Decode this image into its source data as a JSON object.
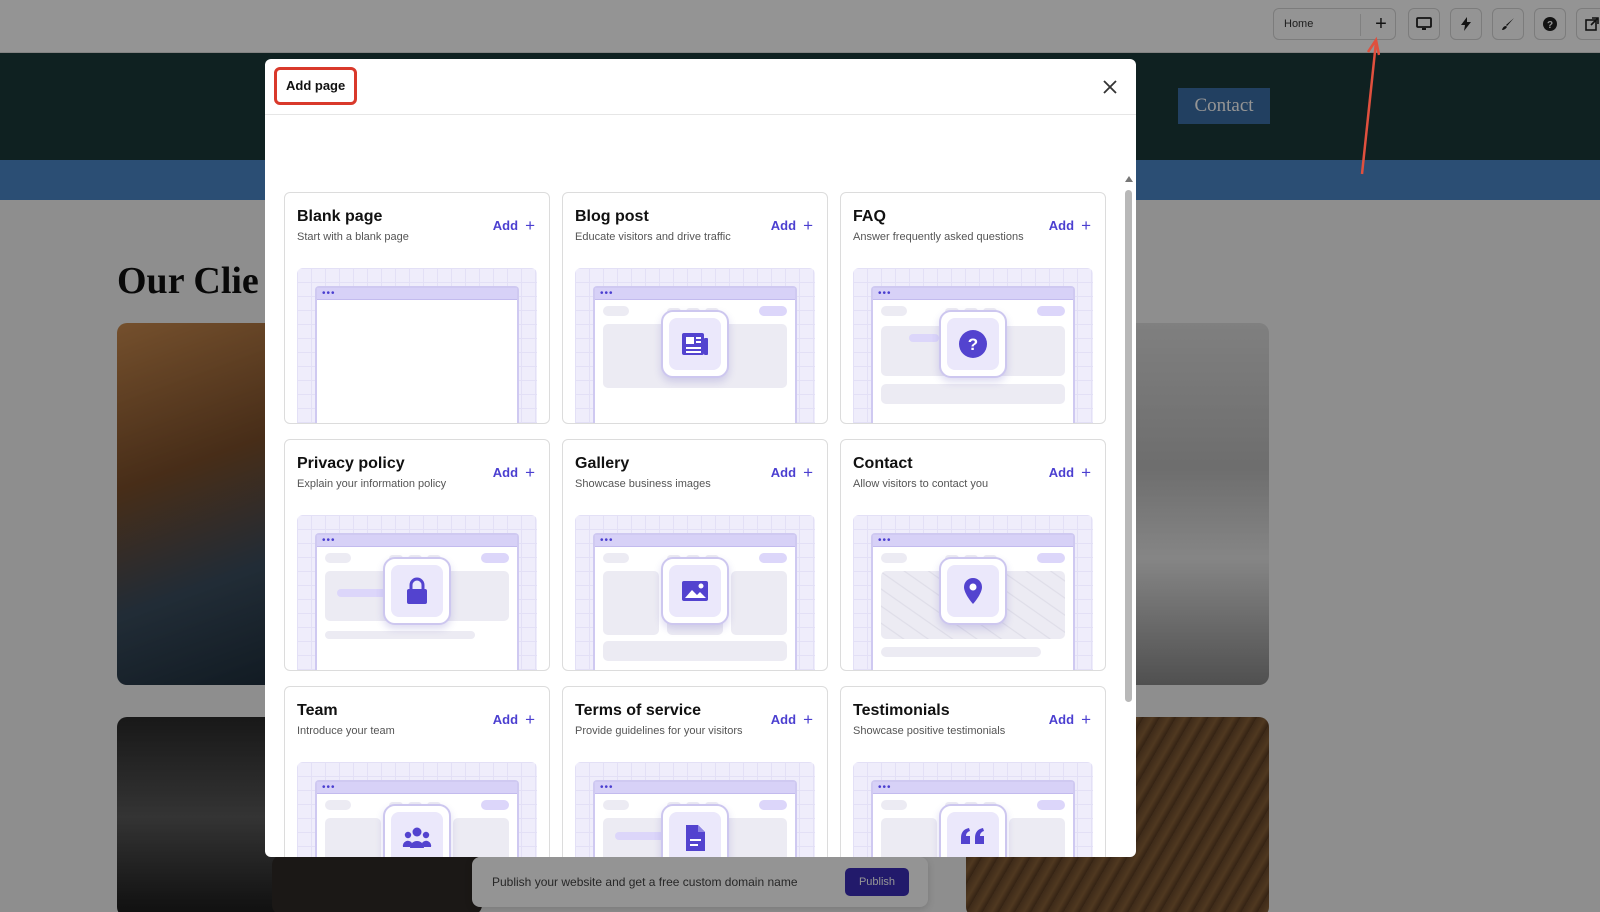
{
  "editor": {
    "page_selector_value": "Home",
    "add_page_icon": "plus-icon",
    "toolbar_icons": [
      "desktop-icon",
      "lightning-icon",
      "brush-icon",
      "help-icon",
      "external-link-icon"
    ]
  },
  "site": {
    "nav_contact": "Contact",
    "heading": "Our Clie",
    "publish_text": "Publish your website and get a free custom domain name",
    "publish_button": "Publish"
  },
  "modal": {
    "title": "Add page",
    "close_icon": "close-icon",
    "add_label": "Add",
    "cards": [
      {
        "title": "Blank page",
        "description": "Start with a blank page",
        "icon": "blank-page-icon"
      },
      {
        "title": "Blog post",
        "description": "Educate visitors and drive traffic",
        "icon": "newspaper-icon"
      },
      {
        "title": "FAQ",
        "description": "Answer frequently asked questions",
        "icon": "question-icon"
      },
      {
        "title": "Privacy policy",
        "description": "Explain your information policy",
        "icon": "lock-icon"
      },
      {
        "title": "Gallery",
        "description": "Showcase business images",
        "icon": "image-icon"
      },
      {
        "title": "Contact",
        "description": "Allow visitors to contact you",
        "icon": "location-pin-icon"
      },
      {
        "title": "Team",
        "description": "Introduce your team",
        "icon": "users-icon"
      },
      {
        "title": "Terms of service",
        "description": "Provide guidelines for your visitors",
        "icon": "document-icon"
      },
      {
        "title": "Testimonials",
        "description": "Showcase positive testimonials",
        "icon": "quote-icon"
      }
    ]
  },
  "colors": {
    "accent": "#4b3fd0",
    "annotation_red": "#d9392b",
    "header_dark": "#1a3a3a",
    "band_blue": "#4b87c9"
  }
}
